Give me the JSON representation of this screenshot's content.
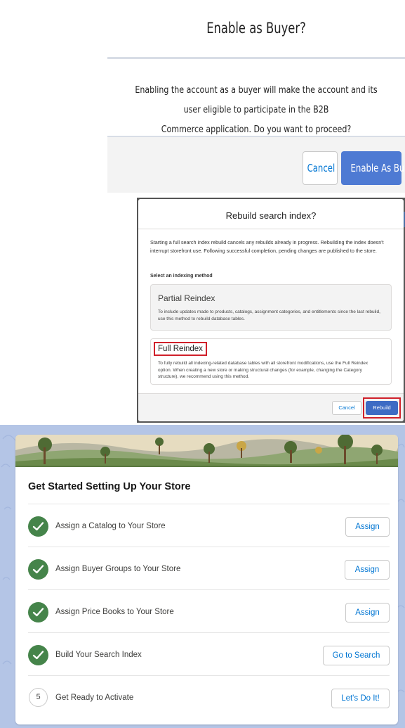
{
  "enable_buyer_dialog": {
    "title": "Enable as Buyer?",
    "message_line1": "Enabling the account as a buyer will make the account and its user eligible to participate in the B2B",
    "message_line2": "Commerce application. Do you want to proceed?",
    "cancel_label": "Cancel",
    "confirm_label": "Enable As Buyer"
  },
  "rebuild_dialog": {
    "title": "Rebuild search index?",
    "description": "Starting a full search index rebuild cancels any rebuilds already in progress. Rebuilding the index doesn't interrupt storefront use. Following successful completion, pending changes are published to the store.",
    "select_label": "Select an indexing method",
    "options": [
      {
        "title": "Partial Reindex",
        "text": "To include updates made to products, catalogs, assignment categories, and entitlements since the last rebuild, use this method to rebuild database tables."
      },
      {
        "title": "Full Reindex",
        "text": "To fully rebuild all indexing-related database tables with all storefront modifications, use the Full Reindex option. When creating a new store or making structural changes (for example, changing the Category structure), we recommend using this method."
      }
    ],
    "cancel_label": "Cancel",
    "rebuild_label": "Rebuild"
  },
  "setup_card": {
    "title": "Get Started Setting Up Your Store",
    "steps": [
      {
        "status": "complete",
        "label": "Assign a Catalog to Your Store",
        "button": "Assign"
      },
      {
        "status": "complete",
        "label": "Assign Buyer Groups to Your Store",
        "button": "Assign"
      },
      {
        "status": "complete",
        "label": "Assign Price Books to Your Store",
        "button": "Assign"
      },
      {
        "status": "complete",
        "label": "Build Your Search Index",
        "button": "Go to Search"
      },
      {
        "status": "pending",
        "number": "5",
        "label": "Get Ready to Activate",
        "button": "Let's Do It!"
      }
    ]
  },
  "colors": {
    "brand_button": "#4e7ad3",
    "link_blue": "#0176d3",
    "highlight_red": "#d0202a",
    "success_green": "#45844a",
    "page_background": "#b4c5e6"
  }
}
